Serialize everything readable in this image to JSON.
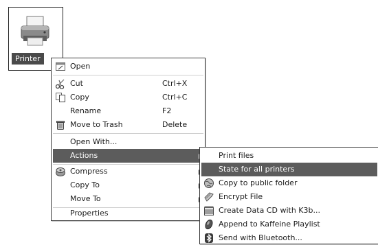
{
  "desktop_icon": {
    "label": "Printer",
    "icon": "printer-icon"
  },
  "context_menu": {
    "items": [
      {
        "label": "Open",
        "shortcut": "",
        "icon": "open-icon"
      },
      {
        "label": "Cut",
        "shortcut": "Ctrl+X",
        "icon": "scissors-icon"
      },
      {
        "label": "Copy",
        "shortcut": "Ctrl+C",
        "icon": "copy-icon"
      },
      {
        "label": "Rename",
        "shortcut": "F2",
        "icon": ""
      },
      {
        "label": "Move to Trash",
        "shortcut": "Delete",
        "icon": "trash-icon"
      },
      {
        "label": "Open With...",
        "shortcut": "",
        "icon": ""
      },
      {
        "label": "Actions",
        "shortcut": "",
        "icon": "",
        "submenu": true,
        "highlighted": true
      },
      {
        "label": "Compress",
        "shortcut": "",
        "icon": "compress-icon",
        "submenu": true
      },
      {
        "label": "Copy To",
        "shortcut": "",
        "icon": "",
        "submenu": true
      },
      {
        "label": "Move To",
        "shortcut": "",
        "icon": "",
        "submenu": true
      },
      {
        "label": "Properties",
        "shortcut": "",
        "icon": ""
      }
    ]
  },
  "actions_submenu": {
    "items": [
      {
        "label": "Print files",
        "icon": ""
      },
      {
        "label": "State for all printers",
        "icon": "",
        "highlighted": true
      },
      {
        "label": "Copy to public folder",
        "icon": "globe-icon"
      },
      {
        "label": "Encrypt File",
        "icon": "key-icon"
      },
      {
        "label": "Create Data CD with K3b...",
        "icon": "cd-icon"
      },
      {
        "label": "Append to Kaffeine Playlist",
        "icon": "media-icon"
      },
      {
        "label": "Send with Bluetooth...",
        "icon": "bluetooth-icon"
      }
    ]
  },
  "colors": {
    "highlight": "#5c5c5c",
    "border": "#3c3c3c",
    "label_bg": "#4a4a4a"
  }
}
